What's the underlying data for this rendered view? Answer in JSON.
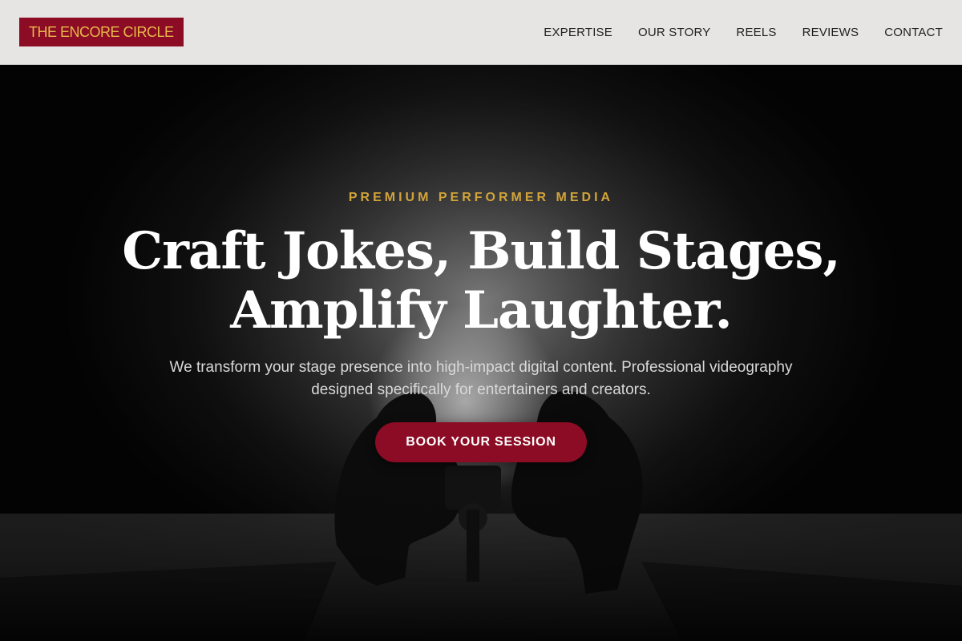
{
  "header": {
    "logo_text": "THE ENCORE CIRCLE",
    "nav": [
      {
        "label": "EXPERTISE"
      },
      {
        "label": "OUR STORY"
      },
      {
        "label": "REELS"
      },
      {
        "label": "REVIEWS"
      },
      {
        "label": "CONTACT"
      }
    ]
  },
  "hero": {
    "eyebrow": "PREMIUM PERFORMER MEDIA",
    "headline_line1": "Craft Jokes, Build Stages,",
    "headline_line2": "Amplify Laughter.",
    "subtitle": "We transform your stage presence into high-impact digital content. Professional videography designed specifically for entertainers and creators.",
    "cta_label": "BOOK YOUR SESSION"
  },
  "colors": {
    "brand_red": "#8b0c24",
    "brand_gold": "#d2a43a",
    "header_bg": "#e7e5e4",
    "hero_bg": "#000000"
  },
  "icons": {
    "hero_image": "camera-crew-silhouette-image"
  }
}
